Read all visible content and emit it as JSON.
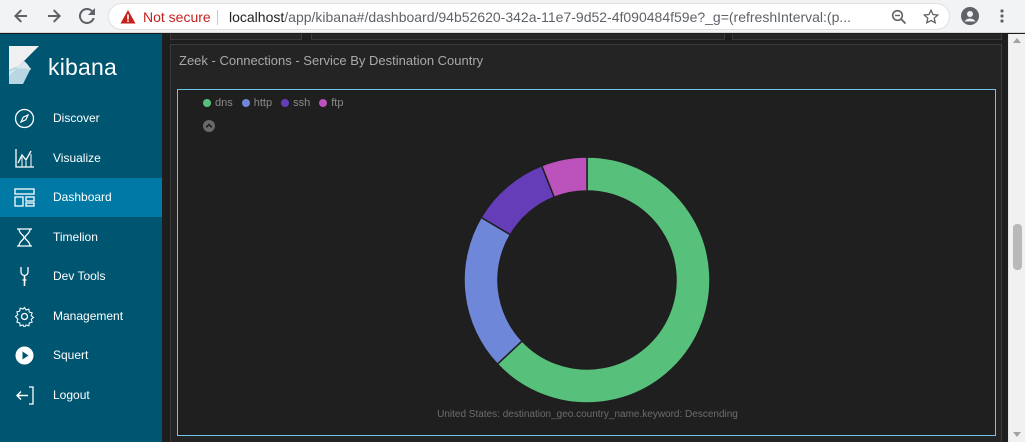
{
  "browser": {
    "not_secure_label": "Not secure",
    "url_host": "localhost",
    "url_path": "/app/kibana#/dashboard/94b52620-342a-11e7-9d52-4f090484f59e?_g=(refreshInterval:(p..."
  },
  "sidebar": {
    "logo_text": "kibana",
    "items": [
      {
        "label": "Discover",
        "icon": "compass-icon"
      },
      {
        "label": "Visualize",
        "icon": "chart-icon"
      },
      {
        "label": "Dashboard",
        "icon": "dashboard-icon",
        "active": true
      },
      {
        "label": "Timelion",
        "icon": "timelion-icon"
      },
      {
        "label": "Dev Tools",
        "icon": "wrench-icon"
      },
      {
        "label": "Management",
        "icon": "gear-icon"
      },
      {
        "label": "Squert",
        "icon": "play-icon"
      },
      {
        "label": "Logout",
        "icon": "logout-icon"
      }
    ]
  },
  "panel": {
    "title": "Zeek - Connections - Service By Destination Country",
    "caption": "United States: destination_geo.country_name.keyword: Descending"
  },
  "colors": {
    "sidebar_bg": "#005571",
    "sidebar_active": "#0079a5",
    "dns": "#57c17b",
    "http": "#6f87d8",
    "ssh": "#663db8",
    "ftp": "#bc52bc"
  },
  "chart_data": {
    "type": "pie",
    "donut": true,
    "legend_position": "top-left",
    "categories": [
      "dns",
      "http",
      "ssh",
      "ftp"
    ],
    "values": [
      63,
      20.5,
      10.5,
      6
    ],
    "colors": [
      "#57c17b",
      "#6f87d8",
      "#663db8",
      "#bc52bc"
    ]
  }
}
